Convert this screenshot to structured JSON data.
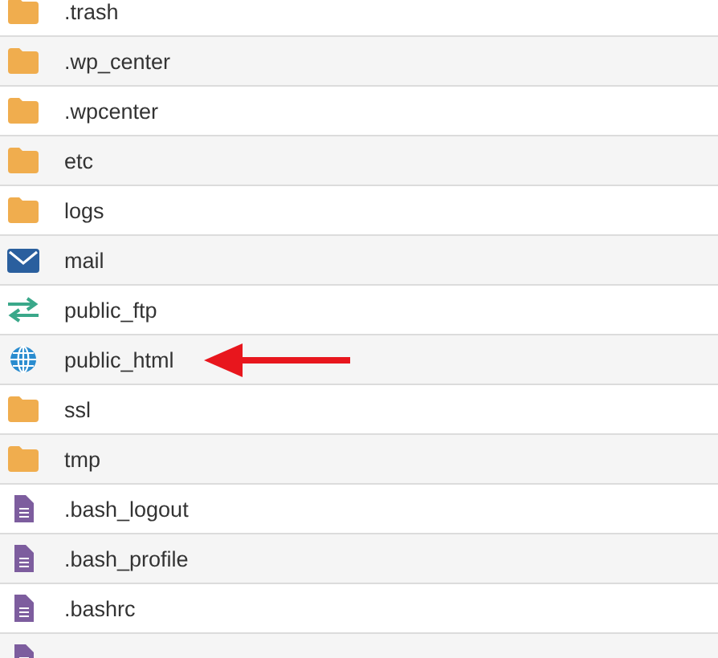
{
  "files": [
    {
      "name": ".trash",
      "kind": "folder",
      "pointed": false
    },
    {
      "name": ".wp_center",
      "kind": "folder",
      "pointed": false
    },
    {
      "name": ".wpcenter",
      "kind": "folder",
      "pointed": false
    },
    {
      "name": "etc",
      "kind": "folder",
      "pointed": false
    },
    {
      "name": "logs",
      "kind": "folder",
      "pointed": false
    },
    {
      "name": "mail",
      "kind": "mail",
      "pointed": false
    },
    {
      "name": "public_ftp",
      "kind": "transfer",
      "pointed": false
    },
    {
      "name": "public_html",
      "kind": "globe",
      "pointed": true
    },
    {
      "name": "ssl",
      "kind": "folder",
      "pointed": false
    },
    {
      "name": "tmp",
      "kind": "folder",
      "pointed": false
    },
    {
      "name": ".bash_logout",
      "kind": "file",
      "pointed": false
    },
    {
      "name": ".bash_profile",
      "kind": "file",
      "pointed": false
    },
    {
      "name": ".bashrc",
      "kind": "file",
      "pointed": false
    },
    {
      "kind": "file",
      "pointed": false
    }
  ]
}
